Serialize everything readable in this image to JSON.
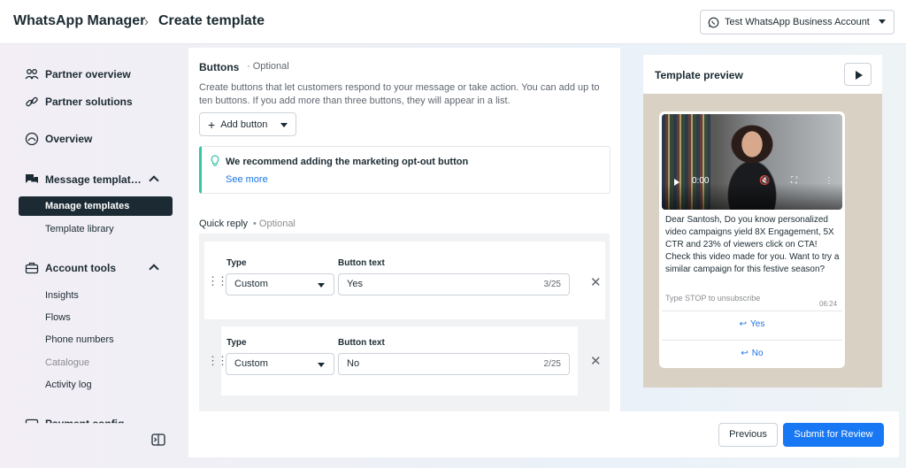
{
  "header": {
    "app_title": "WhatsApp Manager",
    "page_title": "Create template",
    "account_label": "Test WhatsApp Business Account"
  },
  "sidebar": {
    "partner_overview": "Partner overview",
    "partner_solutions": "Partner solutions",
    "overview": "Overview",
    "message_templates": "Message templat…",
    "manage_templates": "Manage templates",
    "template_library": "Template library",
    "account_tools": "Account tools",
    "insights": "Insights",
    "flows": "Flows",
    "phone_numbers": "Phone numbers",
    "catalogue": "Catalogue",
    "activity_log": "Activity log",
    "payment_config": "Payment config"
  },
  "buttons_section": {
    "title": "Buttons",
    "optional": "· Optional",
    "description": "Create buttons that let customers respond to your message or take action. You can add up to ten buttons. If you add more than three buttons, they will appear in a list.",
    "add_button": "Add button",
    "tip_title": "We recommend adding the marketing opt-out button",
    "tip_link": "See more",
    "quick_reply": "Quick reply",
    "quick_reply_optional": "• Optional",
    "type_label": "Type",
    "button_text_label": "Button text",
    "rows": [
      {
        "type": "Custom",
        "text": "Yes",
        "count": "3/25"
      },
      {
        "type": "Custom",
        "text": "No",
        "count": "2/25"
      }
    ]
  },
  "footer": {
    "previous": "Previous",
    "submit": "Submit for Review"
  },
  "preview": {
    "title": "Template preview",
    "video_time": "0:00",
    "body": "Dear Santosh, Do you know personalized video campaigns yield 8X Engagement, 5X CTR and 23% of viewers click on CTA! Check this video made for you. Want to try a similar campaign for this festive season?",
    "footer": "Type STOP to unsubscribe",
    "time": "06:24",
    "replies": [
      "Yes",
      "No"
    ]
  },
  "colors": {
    "primary": "#1877f2",
    "tip_accent": "#37c4a5",
    "active_nav": "#1c2b33",
    "link": "#1b74e4"
  }
}
